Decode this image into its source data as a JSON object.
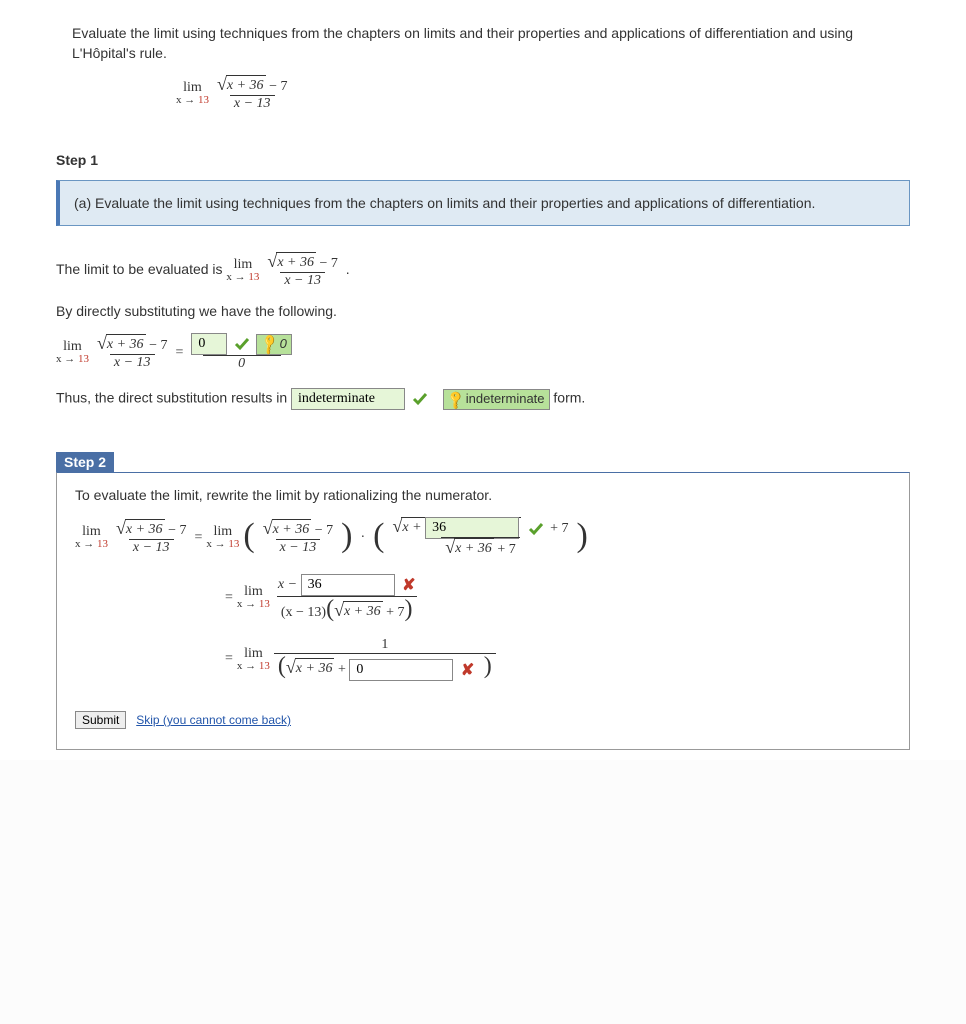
{
  "prompt": "Evaluate the limit using techniques from the chapters on limits and their properties and applications of differentiation and using L'Hôpital's rule.",
  "expr": {
    "lim_label": "lim",
    "approach_prefix": "x → ",
    "approach_val": "13",
    "sqrt_inside": "x + 36",
    "minus_7": " − 7",
    "denom": "x − 13"
  },
  "step1": {
    "head": "Step 1",
    "callout": "(a) Evaluate the limit using techniques from the chapters on limits and their properties and applications of differentiation.",
    "line1a": "The limit to be evaluated is  ",
    "line1b": ".",
    "line2": "By directly substituting we have the following.",
    "eq_equals": " = ",
    "ans_numer": "0",
    "key_numer": "0",
    "den_zero": "0",
    "line3a": "Thus, the direct substitution results in ",
    "ans_form": "indeterminate",
    "key_form": "indeterminate",
    "line3b": " form."
  },
  "step2": {
    "head": "Step 2",
    "line1": "To evaluate the limit, rewrite the limit by rationalizing the numerator.",
    "ans_rat": "36",
    "plus7": " + 7",
    "sqrt_conj": "x + 36",
    "plus7b": " + 7",
    "ans_line2": "36",
    "minus_x": "x − ",
    "denom2a": "(x − 13)",
    "denom2b_inside": "x + 36",
    "plus7c": " + 7",
    "one": "1",
    "denom3_inside": "x + 36",
    "plus_sym": " + ",
    "ans_line3": "0",
    "submit": "Submit",
    "skip": "Skip (you cannot come back)"
  }
}
